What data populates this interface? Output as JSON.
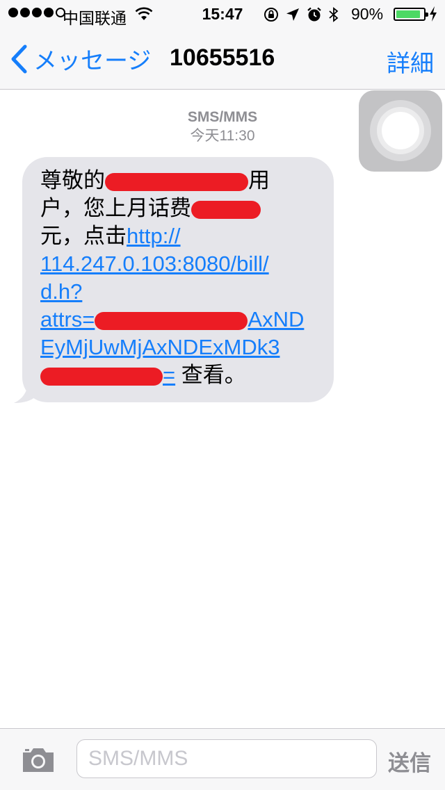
{
  "status_bar": {
    "carrier": "中国联通",
    "time": "15:47",
    "battery_percent_label": "90%",
    "battery_level": 0.9,
    "signal_strength": "4 of 5"
  },
  "nav": {
    "back_label": "メッセージ",
    "title": "10655516",
    "detail_label": "詳細"
  },
  "thread": {
    "service": "SMS/MMS",
    "timestamp": "今天11:30"
  },
  "message": {
    "line1_pre": "尊敬的",
    "line1_post": "用",
    "line2": "户，您上月话费",
    "line3_pre": "元，点击",
    "line3_link": "http://",
    "line4_link": "114.247.0.103:8080/bill/",
    "line5_link": "d.h?",
    "line6_link_pre": "attrs=",
    "line6_link_post": "AxND",
    "line7_link": "EyMjUwMjAxNDExMDk3",
    "line8_link_post": "=",
    "line8_text": " 查看。"
  },
  "compose": {
    "placeholder": "SMS/MMS",
    "send_label": "送信"
  },
  "colors": {
    "accent": "#157efb",
    "bubble": "#e5e5ea",
    "redaction": "#ec1c24",
    "battery_fill": "#4cd964"
  }
}
